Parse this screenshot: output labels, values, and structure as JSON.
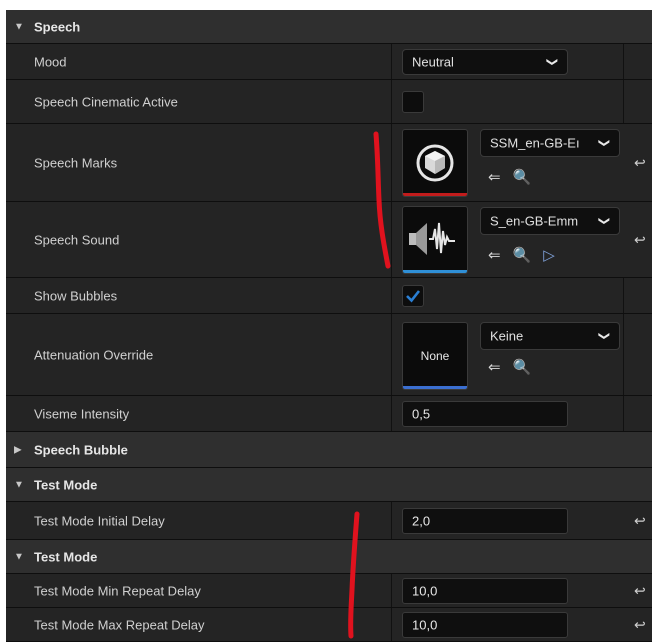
{
  "sections": {
    "speech": "Speech",
    "speech_bubble": "Speech Bubble",
    "test_mode_1": "Test Mode",
    "test_mode_2": "Test Mode"
  },
  "props": {
    "mood": {
      "label": "Mood",
      "value": "Neutral"
    },
    "cinematic": {
      "label": "Speech Cinematic Active",
      "checked": false
    },
    "marks": {
      "label": "Speech Marks",
      "asset": "SSM_en-GB-Eı",
      "bar_color": "#c21c1c"
    },
    "sound": {
      "label": "Speech Sound",
      "asset": "S_en-GB-Emm",
      "bar_color": "#2f8fd6"
    },
    "bubbles": {
      "label": "Show Bubbles",
      "checked": true
    },
    "attenuation": {
      "label": "Attenuation Override",
      "thumb_text": "None",
      "asset": "Keine",
      "bar_color": "#3b6fd1"
    },
    "viseme": {
      "label": "Viseme Intensity",
      "value": "0,5"
    },
    "tm_initial": {
      "label": "Test Mode Initial Delay",
      "value": "2,0"
    },
    "tm_min": {
      "label": "Test Mode Min Repeat Delay",
      "value": "10,0"
    },
    "tm_max": {
      "label": "Test Mode Max Repeat Delay",
      "value": "10,0"
    }
  },
  "icons": {
    "expanded": "triangle-down-icon",
    "collapsed": "triangle-right-icon",
    "reset": "reset-arrow-icon",
    "use": "use-selected-arrow-icon",
    "browse": "browse-folder-icon",
    "play": "play-icon",
    "dropdown": "chevron-down-icon"
  },
  "colors": {
    "accent_check": "#2a7fd4",
    "annotation": "#e0121e"
  }
}
